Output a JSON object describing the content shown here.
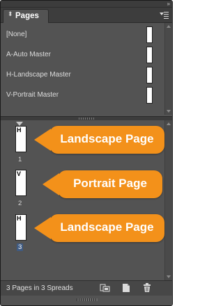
{
  "panel": {
    "tab_label": "Pages",
    "tab_grip_glyph": "⬍",
    "collapse_glyph": "»"
  },
  "masters": [
    {
      "label": "[None]"
    },
    {
      "label": "A-Auto Master"
    },
    {
      "label": "H-Landscape Master"
    },
    {
      "label": "V-Portrait Master"
    }
  ],
  "pages": [
    {
      "tag": "H",
      "number": "1",
      "selected": false,
      "orientation": "landscape"
    },
    {
      "tag": "V",
      "number": "2",
      "selected": false,
      "orientation": "portrait"
    },
    {
      "tag": "H",
      "number": "3",
      "selected": true,
      "orientation": "landscape"
    }
  ],
  "callouts": [
    {
      "text": "Landscape Page"
    },
    {
      "text": "Portrait Page"
    },
    {
      "text": "Landscape Page"
    }
  ],
  "footer": {
    "status": "3 Pages in 3 Spreads",
    "buttons": [
      {
        "icon": "edit-page-size-icon"
      },
      {
        "icon": "new-page-icon"
      },
      {
        "icon": "delete-page-icon"
      }
    ]
  },
  "colors": {
    "panel_bg": "#535353",
    "callout": "#f3911a",
    "selection": "#3f5b83"
  }
}
